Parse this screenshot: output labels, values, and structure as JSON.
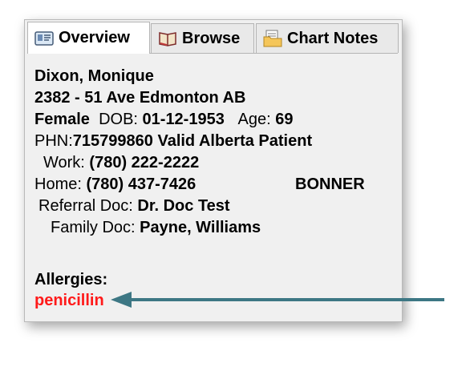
{
  "tabs": {
    "overview": "Overview",
    "browse": "Browse",
    "chart_notes": "Chart Notes"
  },
  "patient": {
    "name": "Dixon, Monique",
    "address": "2382 - 51 Ave Edmonton  AB",
    "sex": "Female",
    "dob_label": "DOB:",
    "dob": "01-12-1953",
    "age_label": "Age:",
    "age": "69",
    "phn_label": "PHN:",
    "phn_value": "715799860 Valid Alberta Patient",
    "work_label": "Work:",
    "work_phone": "(780) 222-2222",
    "home_label": "Home:",
    "home_phone": "(780) 437-7426",
    "home_extra": "BONNER",
    "referral_label": "Referral Doc:",
    "referral_doc": "Dr. Doc Test",
    "family_label": "Family Doc:",
    "family_doc": "Payne, Williams"
  },
  "allergies": {
    "label": "Allergies:",
    "value": "penicillin",
    "color": "#ff1a1a"
  },
  "icons": {
    "overview": "id-card-icon",
    "browse": "book-icon",
    "chart_notes": "notes-folder-icon",
    "annotation": "arrow-left-icon"
  },
  "colors": {
    "arrow": "#3d7784"
  }
}
